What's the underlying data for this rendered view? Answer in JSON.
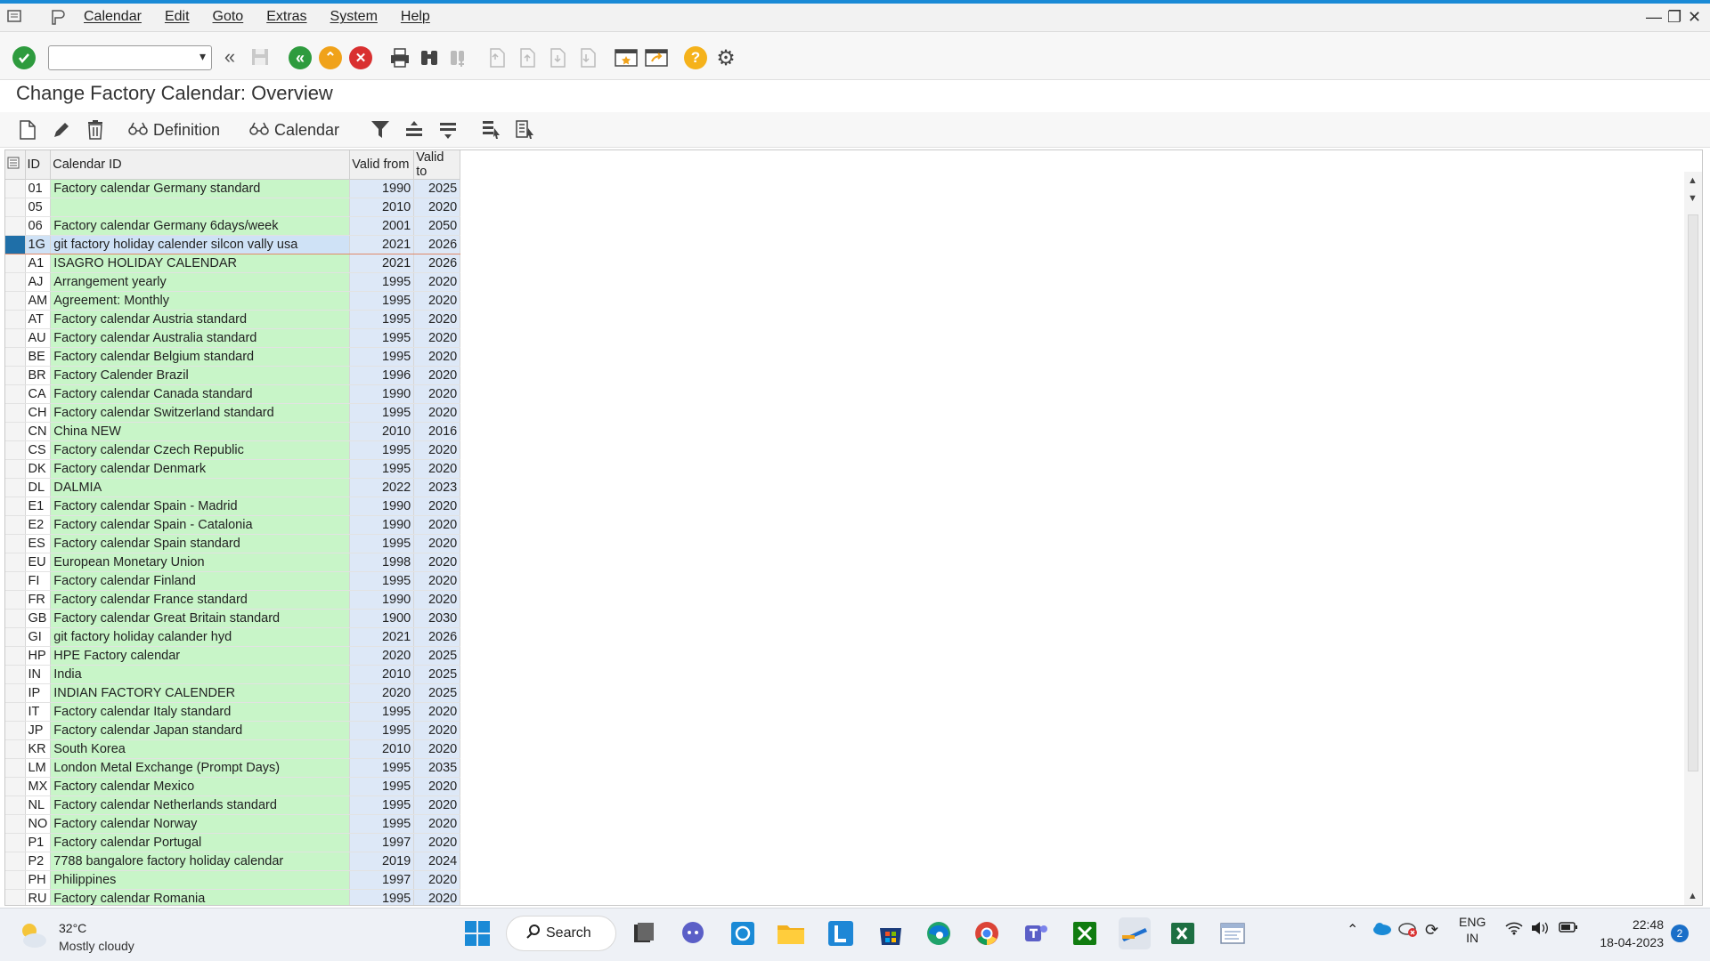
{
  "menubar": {
    "items": [
      "Calendar",
      "Edit",
      "Goto",
      "Extras",
      "System",
      "Help"
    ]
  },
  "page_title": "Change Factory Calendar: Overview",
  "app_toolbar": {
    "definition_label": "Definition",
    "calendar_label": "Calendar"
  },
  "table": {
    "headers": {
      "id": "ID",
      "desc": "Calendar ID",
      "from": "Valid from",
      "to": "Valid to"
    },
    "rows": [
      {
        "id": "01",
        "desc": "Factory calendar Germany standard",
        "from": "1990",
        "to": "2025"
      },
      {
        "id": "05",
        "desc": "",
        "from": "2010",
        "to": "2020"
      },
      {
        "id": "06",
        "desc": "Factory calendar Germany 6days/week",
        "from": "2001",
        "to": "2050"
      },
      {
        "id": "1G",
        "desc": "git factory holiday calender silcon vally usa",
        "from": "2021",
        "to": "2026"
      },
      {
        "id": "A1",
        "desc": "ISAGRO HOLIDAY CALENDAR",
        "from": "2021",
        "to": "2026"
      },
      {
        "id": "AJ",
        "desc": "Arrangement yearly",
        "from": "1995",
        "to": "2020"
      },
      {
        "id": "AM",
        "desc": "Agreement: Monthly",
        "from": "1995",
        "to": "2020"
      },
      {
        "id": "AT",
        "desc": "Factory calendar Austria standard",
        "from": "1995",
        "to": "2020"
      },
      {
        "id": "AU",
        "desc": "Factory calendar Australia standard",
        "from": "1995",
        "to": "2020"
      },
      {
        "id": "BE",
        "desc": "Factory calendar Belgium standard",
        "from": "1995",
        "to": "2020"
      },
      {
        "id": "BR",
        "desc": "Factory Calender Brazil",
        "from": "1996",
        "to": "2020"
      },
      {
        "id": "CA",
        "desc": "Factory calendar Canada standard",
        "from": "1990",
        "to": "2020"
      },
      {
        "id": "CH",
        "desc": "Factory calendar Switzerland standard",
        "from": "1995",
        "to": "2020"
      },
      {
        "id": "CN",
        "desc": "China NEW",
        "from": "2010",
        "to": "2016"
      },
      {
        "id": "CS",
        "desc": "Factory calendar Czech Republic",
        "from": "1995",
        "to": "2020"
      },
      {
        "id": "DK",
        "desc": "Factory calendar Denmark",
        "from": "1995",
        "to": "2020"
      },
      {
        "id": "DL",
        "desc": "DALMIA",
        "from": "2022",
        "to": "2023"
      },
      {
        "id": "E1",
        "desc": "Factory calendar Spain - Madrid",
        "from": "1990",
        "to": "2020"
      },
      {
        "id": "E2",
        "desc": "Factory calendar Spain - Catalonia",
        "from": "1990",
        "to": "2020"
      },
      {
        "id": "ES",
        "desc": "Factory calendar Spain standard",
        "from": "1995",
        "to": "2020"
      },
      {
        "id": "EU",
        "desc": "European Monetary Union",
        "from": "1998",
        "to": "2020"
      },
      {
        "id": "FI",
        "desc": "Factory calendar Finland",
        "from": "1995",
        "to": "2020"
      },
      {
        "id": "FR",
        "desc": "Factory calendar France standard",
        "from": "1990",
        "to": "2020"
      },
      {
        "id": "GB",
        "desc": "Factory calendar Great Britain standard",
        "from": "1900",
        "to": "2030"
      },
      {
        "id": "GI",
        "desc": "git factory holiday calander hyd",
        "from": "2021",
        "to": "2026"
      },
      {
        "id": "HP",
        "desc": "HPE Factory calendar",
        "from": "2020",
        "to": "2025"
      },
      {
        "id": "IN",
        "desc": "India",
        "from": "2010",
        "to": "2025"
      },
      {
        "id": "IP",
        "desc": "INDIAN FACTORY CALENDER",
        "from": "2020",
        "to": "2025"
      },
      {
        "id": "IT",
        "desc": "Factory calendar Italy standard",
        "from": "1995",
        "to": "2020"
      },
      {
        "id": "JP",
        "desc": "Factory calendar Japan standard",
        "from": "1995",
        "to": "2020"
      },
      {
        "id": "KR",
        "desc": "South Korea",
        "from": "2010",
        "to": "2020"
      },
      {
        "id": "LM",
        "desc": "London Metal Exchange (Prompt Days)",
        "from": "1995",
        "to": "2035"
      },
      {
        "id": "MX",
        "desc": "Factory calendar Mexico",
        "from": "1995",
        "to": "2020"
      },
      {
        "id": "NL",
        "desc": "Factory calendar Netherlands standard",
        "from": "1995",
        "to": "2020"
      },
      {
        "id": "NO",
        "desc": "Factory calendar Norway",
        "from": "1995",
        "to": "2020"
      },
      {
        "id": "P1",
        "desc": "Factory calendar Portugal",
        "from": "1997",
        "to": "2020"
      },
      {
        "id": "P2",
        "desc": "7788  bangalore  factory holiday calendar",
        "from": "2019",
        "to": "2024"
      },
      {
        "id": "PH",
        "desc": "Philippines",
        "from": "1997",
        "to": "2020"
      },
      {
        "id": "RU",
        "desc": "Factory calendar Romania",
        "from": "1995",
        "to": "2020"
      }
    ],
    "selected_row_index": 3
  },
  "taskbar": {
    "weather_temp": "32°C",
    "weather_desc": "Mostly cloudy",
    "search_label": "Search",
    "lang_top": "ENG",
    "lang_bottom": "IN",
    "time": "22:48",
    "date": "18-04-2023",
    "notification_count": "2"
  },
  "colors": {
    "accent": "#1a8ad6",
    "desc_cell": "#c8f5c8",
    "num_cell": "#dde8f7",
    "selected_marker": "#1f6fa8"
  }
}
